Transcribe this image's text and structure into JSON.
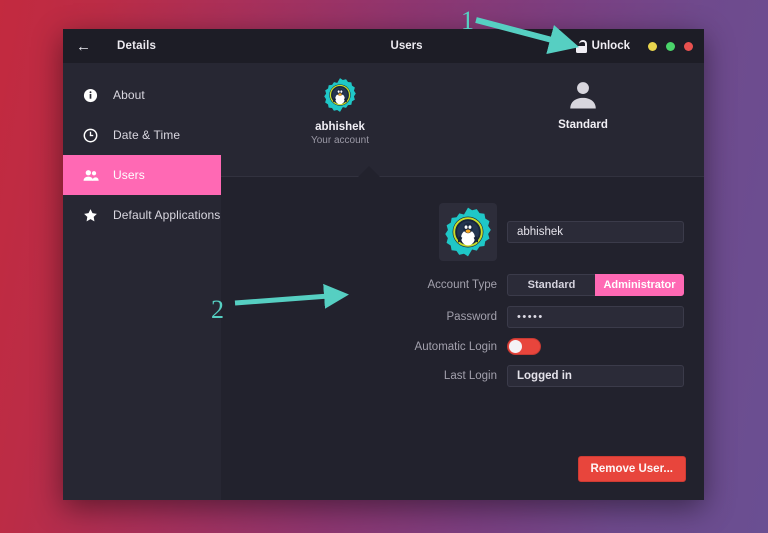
{
  "window": {
    "titlebar": {
      "back_icon": "back-arrow-icon",
      "left_title": "Details",
      "center_title": "Users",
      "unlock_label": "Unlock",
      "lock_icon": "lock-open-icon",
      "controls": [
        {
          "name": "minimize",
          "color": "#e8d44d"
        },
        {
          "name": "maximize",
          "color": "#4ad46a"
        },
        {
          "name": "close",
          "color": "#e8514f"
        }
      ]
    }
  },
  "sidebar": {
    "items": [
      {
        "label": "About",
        "icon": "info-icon",
        "active": false
      },
      {
        "label": "Date & Time",
        "icon": "clock-icon",
        "active": false
      },
      {
        "label": "Users",
        "icon": "users-icon",
        "active": true
      },
      {
        "label": "Default Applications",
        "icon": "star-icon",
        "active": false
      }
    ],
    "active_color": "#ff69b4"
  },
  "carousel": {
    "users": [
      {
        "name": "abhishek",
        "subtitle": "Your account",
        "avatar": "tux-gear-avatar-icon",
        "selected": true
      },
      {
        "name": "Standard",
        "subtitle": "",
        "avatar": "person-avatar-icon",
        "selected": false
      }
    ]
  },
  "form": {
    "avatar_icon": "tux-gear-avatar-icon",
    "username_value": "abhishek",
    "account_type_label": "Account Type",
    "account_type_options": [
      "Standard",
      "Administrator"
    ],
    "account_type_selected": "Administrator",
    "password_label": "Password",
    "password_value": "•••••",
    "automatic_login_label": "Automatic Login",
    "automatic_login_on": false,
    "last_login_label": "Last Login",
    "last_login_value": "Logged in",
    "remove_user_label": "Remove User..."
  },
  "annotations": {
    "marker_color": "#56cfc2",
    "items": [
      {
        "number": "1",
        "target": "unlock-button"
      },
      {
        "number": "2",
        "target": "password-field"
      }
    ]
  }
}
